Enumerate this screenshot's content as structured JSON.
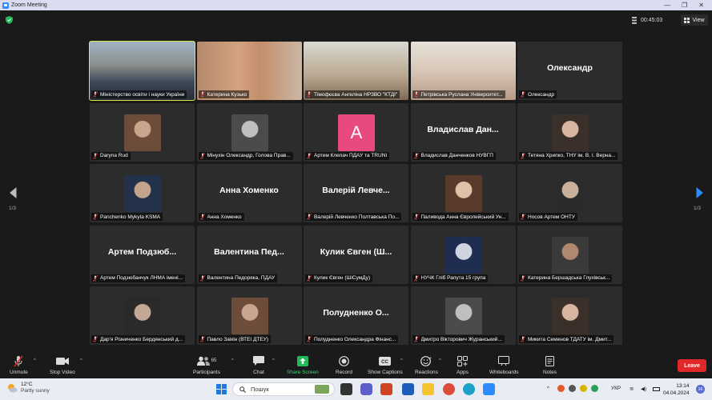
{
  "window": {
    "title": "Zoom Meeting"
  },
  "topbar": {
    "timer": "00:45:03",
    "view_label": "View"
  },
  "pagination": {
    "left": "1/3",
    "right": "1/3"
  },
  "participants": [
    {
      "caption": "Міністерство освіти і науки України",
      "type": "video",
      "active": true
    },
    {
      "caption": "Катерина Кузько",
      "type": "video"
    },
    {
      "caption": "Тімофєєва Ангеліна НРЗВО \"КТДІ\"",
      "type": "video"
    },
    {
      "caption": "Петрівська Руслана Університет...",
      "type": "video"
    },
    {
      "caption": "Олександр",
      "type": "name",
      "display": "Олександр"
    },
    {
      "caption": "Daryna Rud",
      "type": "photo"
    },
    {
      "caption": "Мінухін Олександр, Голова Прав...",
      "type": "photo"
    },
    {
      "caption": "Артем Клепач ПДАУ та TRUNI",
      "type": "letter",
      "letter": "A"
    },
    {
      "caption": "Владислав Данченков НУВГП",
      "type": "name",
      "display": "Владислав Дан..."
    },
    {
      "caption": "Тетяна Хрипко, ТНУ ім. В. І. Верна...",
      "type": "photo"
    },
    {
      "caption": "Panchenko Mykyta KSMA",
      "type": "photo"
    },
    {
      "caption": "Анна Хоменко",
      "type": "name",
      "display": "Анна Хоменко"
    },
    {
      "caption": "Валерій Левченко Полтавська По...",
      "type": "name",
      "display": "Валерій Левче..."
    },
    {
      "caption": "Паливода Анна Європейський Ун...",
      "type": "photo"
    },
    {
      "caption": "Носов Артем ОНТУ",
      "type": "photo"
    },
    {
      "caption": "Артем Подзюбанчук ЛНМА імені...",
      "type": "name",
      "display": "Артем Подзюб..."
    },
    {
      "caption": "Валентина Педоряка, ПДАУ",
      "type": "name",
      "display": "Валентина Пед..."
    },
    {
      "caption": "Кулик Євген (ШіСумДу)",
      "type": "name",
      "display": "Кулик Євген (Ш..."
    },
    {
      "caption": "НУЧК Гліб Рапута 15 група",
      "type": "photo"
    },
    {
      "caption": "Катерина Бершадська Глухівськ...",
      "type": "photo"
    },
    {
      "caption": "Дар'я Різниченко Бердянський д...",
      "type": "photo"
    },
    {
      "caption": "Павло Заікін (ВТЕІ ДТЕУ)",
      "type": "photo"
    },
    {
      "caption": "Полудненко Олександра Фінанс...",
      "type": "name",
      "display": "Полудненко О..."
    },
    {
      "caption": "Дмитро Вікторович Журанський...",
      "type": "photo"
    },
    {
      "caption": "Микита Семенов ТДАТУ ім. Дмит...",
      "type": "photo"
    }
  ],
  "toolbar": {
    "unmute": "Unmute",
    "stop_video": "Stop Video",
    "participants": "Participants",
    "participants_count": "65",
    "chat": "Chat",
    "share_screen": "Share Screen",
    "record": "Record",
    "show_captions": "Show Captions",
    "reactions": "Reactions",
    "apps": "Apps",
    "whiteboards": "Whiteboards",
    "notes": "Notes",
    "leave": "Leave"
  },
  "taskbar": {
    "temp": "12°C",
    "weather": "Partly sunny",
    "search": "Пошук",
    "lang": "УКР",
    "time": "13:14",
    "date": "04.04.2024",
    "notif_count": "16"
  },
  "colors": {
    "accent_green": "#3cd27a",
    "leave_red": "#e02828",
    "active_border": "#d8e84a",
    "zoom_blue": "#2d8cff"
  }
}
